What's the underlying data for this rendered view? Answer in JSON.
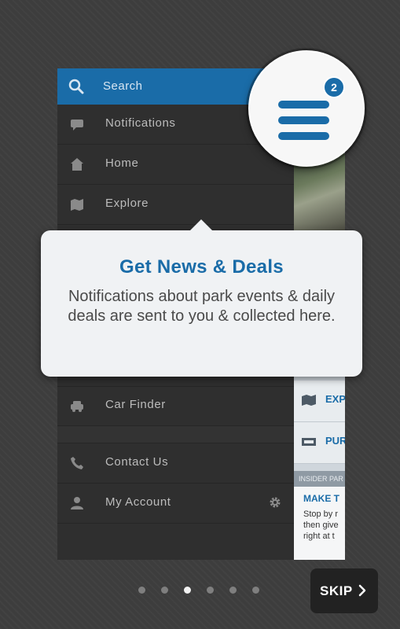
{
  "drawer": {
    "search_label": "Search",
    "items": [
      {
        "label": "Notifications",
        "icon": "chat-bubble-icon"
      },
      {
        "label": "Home",
        "icon": "home-icon"
      },
      {
        "label": "Explore",
        "icon": "map-icon"
      },
      {
        "label": "Car Finder",
        "icon": "car-icon"
      },
      {
        "label": "Contact Us",
        "icon": "phone-icon"
      },
      {
        "label": "My Account",
        "icon": "person-icon"
      }
    ]
  },
  "menu_badge": {
    "count": "2",
    "icon": "hamburger-menu-icon",
    "accent_color": "#1a6ca8"
  },
  "tooltip": {
    "title": "Get News & Deals",
    "body": "Notifications about park events & daily deals are sent to you & collected here."
  },
  "background_content": {
    "card1": "EXP",
    "card2": "PUR",
    "insider": "INSIDER PAR",
    "article_head": "MAKE T",
    "article_body": "Stop by r\nthen give\nright at t"
  },
  "pager": {
    "page_count": 6,
    "active_index": 2
  },
  "skip": {
    "label": "SKIP"
  }
}
